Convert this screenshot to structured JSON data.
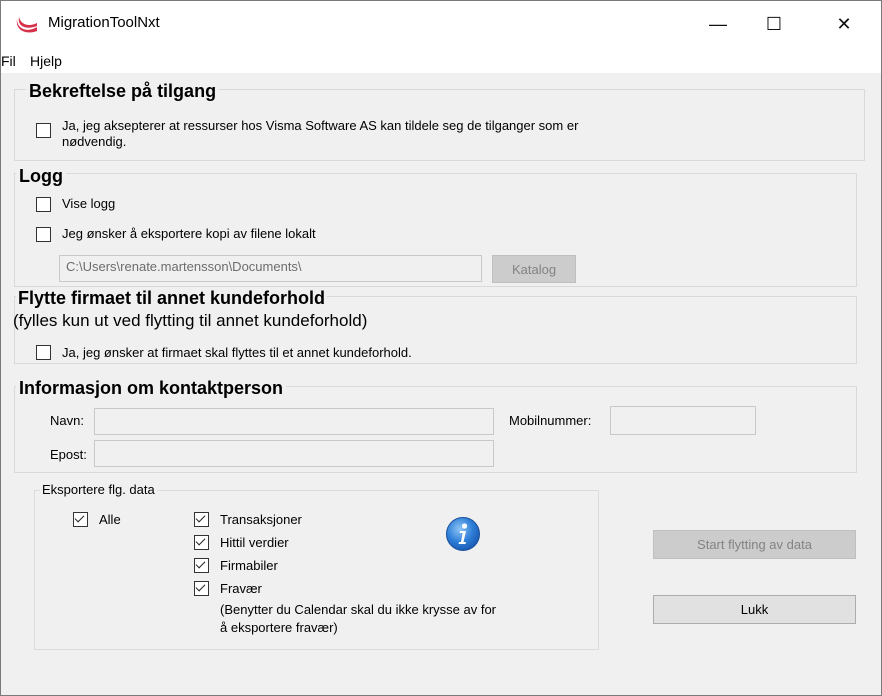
{
  "window": {
    "title": "MigrationToolNxt",
    "minimize_glyph": "—",
    "maximize_glyph": "☐",
    "close_glyph": "✕",
    "icon": "app-logo-icon",
    "accent": "#d6304a"
  },
  "menu": {
    "file": "Fil",
    "help": "Hjelp"
  },
  "access": {
    "heading": "Bekreftelse på tilgang",
    "checkbox_text_1": "Ja, jeg aksepterer at ressurser hos Visma Software AS kan tildele seg de tilganger som er",
    "checkbox_text_2": "nødvendig.",
    "checked": false
  },
  "log": {
    "heading": "Logg",
    "show_log": "Vise logg",
    "export_copy": "Jeg ønsker å eksportere kopi av filene lokalt",
    "path_value": "C:\\Users\\renate.martensson\\Documents\\",
    "catalog_button": "Katalog"
  },
  "move": {
    "heading": "Flytte firmaet til annet kundeforhold",
    "subheading": "(fylles kun ut ved flytting til  annet kundeforhold)",
    "checkbox_text": "Ja, jeg ønsker at firmaet skal flyttes til et annet kundeforhold."
  },
  "contact": {
    "heading": "Informasjon om kontaktperson",
    "name_label": "Navn:",
    "mobile_label": "Mobilnummer:",
    "email_label": "Epost:"
  },
  "export": {
    "legend": "Eksportere flg. data",
    "all": "Alle",
    "transactions": "Transaksjoner",
    "history": "Hittil verdier",
    "company_cars": "Firmabiler",
    "absence": "Fravær",
    "note_1": "(Benytter du Calendar skal du ikke krysse av for",
    "note_2": "å eksportere fravær)",
    "info_icon": "info-icon"
  },
  "buttons": {
    "start": "Start flytting av data",
    "close": "Lukk"
  }
}
